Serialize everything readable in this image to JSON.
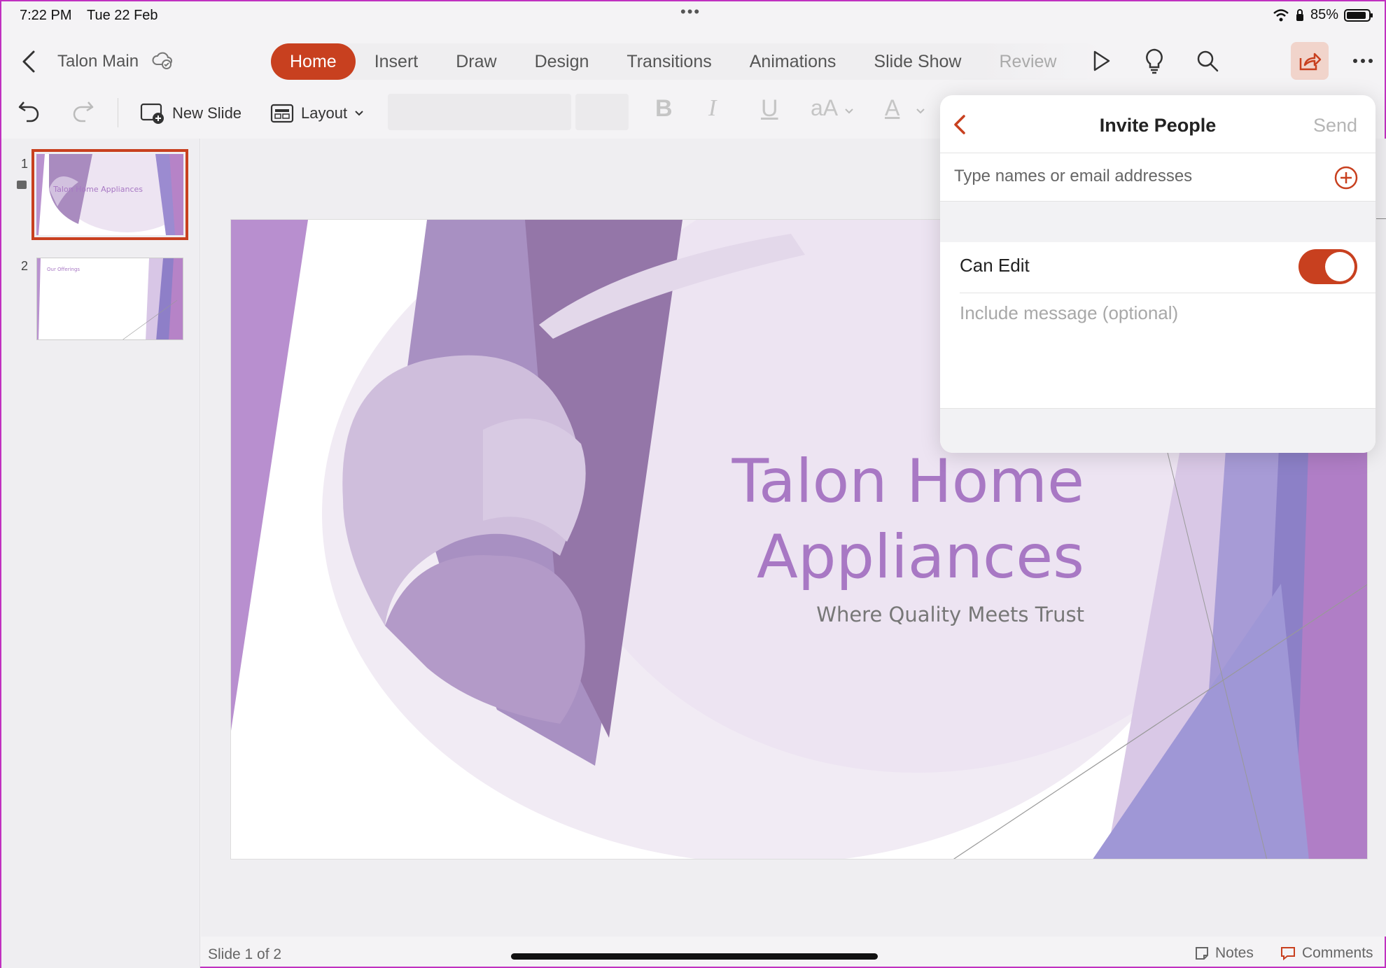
{
  "status": {
    "time": "7:22 PM",
    "date": "Tue 22 Feb",
    "battery": "85%"
  },
  "doc": {
    "title": "Talon Main"
  },
  "tabs": [
    {
      "label": "Home",
      "active": true
    },
    {
      "label": "Insert"
    },
    {
      "label": "Draw"
    },
    {
      "label": "Design"
    },
    {
      "label": "Transitions"
    },
    {
      "label": "Animations"
    },
    {
      "label": "Slide Show"
    },
    {
      "label": "Review"
    }
  ],
  "toolbar": {
    "new_slide": "New Slide",
    "layout": "Layout",
    "bold": "B",
    "italic": "I",
    "underline": "U",
    "font_size": "aA",
    "font_color": "A"
  },
  "thumbnails": [
    {
      "number": "1",
      "title": "Talon Home Appliances"
    },
    {
      "number": "2",
      "title": "Our Offerings"
    }
  ],
  "slide": {
    "title": "Talon Home\nAppliances",
    "subtitle": "Where Quality Meets Trust"
  },
  "footer": {
    "slide_count": "Slide 1 of 2",
    "notes": "Notes",
    "comments": "Comments"
  },
  "invite": {
    "title": "Invite People",
    "send": "Send",
    "input_placeholder": "Type names or email addresses",
    "can_edit": "Can Edit",
    "can_edit_on": true,
    "message_placeholder": "Include message (optional)"
  },
  "colors": {
    "accent": "#c8401f",
    "slide_purple": "#a878c4"
  }
}
